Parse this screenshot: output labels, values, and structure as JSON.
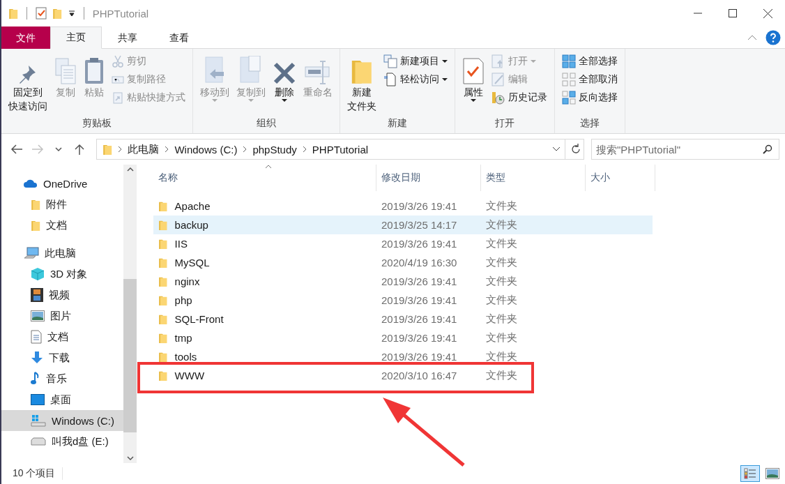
{
  "window": {
    "title": "PHPTutorial"
  },
  "ribbon_tabs": [
    {
      "label": "文件",
      "kind": "file",
      "selected": false
    },
    {
      "label": "主页",
      "kind": "tab",
      "selected": true
    },
    {
      "label": "共享",
      "kind": "tab",
      "selected": false
    },
    {
      "label": "查看",
      "kind": "tab",
      "selected": false
    }
  ],
  "ribbon_groups": [
    {
      "label": "剪贴板",
      "items": [
        {
          "kind": "large",
          "lines": [
            "固定到",
            "快速访问"
          ],
          "disabled": false,
          "dropdown": false
        },
        {
          "kind": "large",
          "lines": [
            "复制"
          ],
          "disabled": true,
          "dropdown": false
        },
        {
          "kind": "large",
          "lines": [
            "粘贴"
          ],
          "disabled": true,
          "dropdown": false
        },
        {
          "kind": "stack",
          "items": [
            {
              "label": "剪切",
              "disabled": true,
              "dropdown": false
            },
            {
              "label": "复制路径",
              "disabled": true,
              "dropdown": false
            },
            {
              "label": "粘贴快捷方式",
              "disabled": true,
              "dropdown": false
            }
          ]
        }
      ]
    },
    {
      "label": "组织",
      "items": [
        {
          "kind": "large",
          "lines": [
            "移动到"
          ],
          "disabled": true,
          "dropdown": true
        },
        {
          "kind": "large",
          "lines": [
            "复制到"
          ],
          "disabled": true,
          "dropdown": true
        },
        {
          "kind": "large",
          "lines": [
            "删除"
          ],
          "disabled": false,
          "dropdown": true
        },
        {
          "kind": "large",
          "lines": [
            "重命名"
          ],
          "disabled": true,
          "dropdown": false
        }
      ]
    },
    {
      "label": "新建",
      "items": [
        {
          "kind": "large",
          "lines": [
            "新建",
            "文件夹"
          ],
          "disabled": false,
          "dropdown": false
        },
        {
          "kind": "stack",
          "items": [
            {
              "label": "新建项目",
              "disabled": false,
              "dropdown": true
            },
            {
              "label": "轻松访问",
              "disabled": false,
              "dropdown": true
            }
          ]
        }
      ]
    },
    {
      "label": "打开",
      "items": [
        {
          "kind": "large",
          "lines": [
            "属性"
          ],
          "disabled": false,
          "dropdown": true
        },
        {
          "kind": "stack",
          "items": [
            {
              "label": "打开",
              "disabled": true,
              "dropdown": true
            },
            {
              "label": "编辑",
              "disabled": true,
              "dropdown": false
            },
            {
              "label": "历史记录",
              "disabled": false,
              "dropdown": false
            }
          ]
        }
      ]
    },
    {
      "label": "选择",
      "items": [
        {
          "kind": "stack",
          "items": [
            {
              "label": "全部选择",
              "disabled": false,
              "dropdown": false
            },
            {
              "label": "全部取消",
              "disabled": false,
              "dropdown": false
            },
            {
              "label": "反向选择",
              "disabled": false,
              "dropdown": false
            }
          ]
        }
      ]
    }
  ],
  "history": {
    "back_disabled": false,
    "forward_disabled": true
  },
  "address": {
    "crumbs": [
      "此电脑",
      "Windows (C:)",
      "phpStudy",
      "PHPTutorial"
    ]
  },
  "search": {
    "placeholder": "搜索\"PHPTutorial\""
  },
  "nav": [
    {
      "label": "OneDrive",
      "selected": false,
      "children": [
        {
          "label": "附件",
          "selected": false
        },
        {
          "label": "文档",
          "selected": false
        }
      ]
    },
    {
      "label": "此电脑",
      "selected": false,
      "children": [
        {
          "label": "3D 对象",
          "selected": false
        },
        {
          "label": "视频",
          "selected": false
        },
        {
          "label": "图片",
          "selected": false
        },
        {
          "label": "文档",
          "selected": false
        },
        {
          "label": "下载",
          "selected": false
        },
        {
          "label": "音乐",
          "selected": false
        },
        {
          "label": "桌面",
          "selected": false
        },
        {
          "label": "Windows (C:)",
          "selected": true
        },
        {
          "label": "叫我d盘 (E:)",
          "selected": false
        }
      ]
    }
  ],
  "files": {
    "columns": [
      {
        "label": "名称",
        "sorted": true
      },
      {
        "label": "修改日期",
        "sorted": false
      },
      {
        "label": "类型",
        "sorted": false
      },
      {
        "label": "大小",
        "sorted": false
      }
    ],
    "rows": [
      {
        "name": "Apache",
        "modified": "2019/3/26 19:41",
        "type": "文件夹",
        "highlighted": false,
        "annotated": false
      },
      {
        "name": "backup",
        "modified": "2019/3/25 14:17",
        "type": "文件夹",
        "highlighted": true,
        "annotated": false
      },
      {
        "name": "IIS",
        "modified": "2019/3/26 19:41",
        "type": "文件夹",
        "highlighted": false,
        "annotated": false
      },
      {
        "name": "MySQL",
        "modified": "2020/4/19 16:30",
        "type": "文件夹",
        "highlighted": false,
        "annotated": false
      },
      {
        "name": "nginx",
        "modified": "2019/3/26 19:41",
        "type": "文件夹",
        "highlighted": false,
        "annotated": false
      },
      {
        "name": "php",
        "modified": "2019/3/26 19:41",
        "type": "文件夹",
        "highlighted": false,
        "annotated": false
      },
      {
        "name": "SQL-Front",
        "modified": "2019/3/26 19:41",
        "type": "文件夹",
        "highlighted": false,
        "annotated": false
      },
      {
        "name": "tmp",
        "modified": "2019/3/26 19:41",
        "type": "文件夹",
        "highlighted": false,
        "annotated": false
      },
      {
        "name": "tools",
        "modified": "2019/3/26 19:41",
        "type": "文件夹",
        "highlighted": false,
        "annotated": false
      },
      {
        "name": "WWW",
        "modified": "2020/3/10 16:47",
        "type": "文件夹",
        "highlighted": false,
        "annotated": true
      }
    ]
  },
  "status_bar": {
    "item_count": "10 个项目"
  },
  "views": [
    {
      "selected": true
    },
    {
      "selected": false
    }
  ]
}
